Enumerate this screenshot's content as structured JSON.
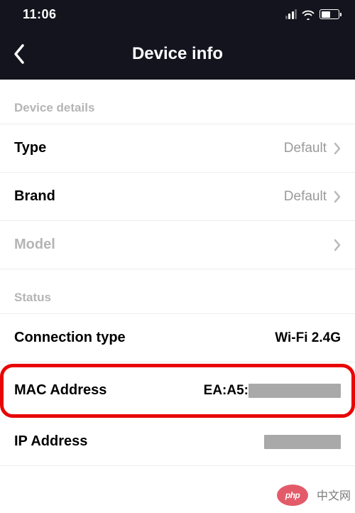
{
  "status_bar": {
    "time": "11:06"
  },
  "header": {
    "title": "Device info"
  },
  "sections": {
    "details": {
      "header": "Device details",
      "type": {
        "label": "Type",
        "value": "Default"
      },
      "brand": {
        "label": "Brand",
        "value": "Default"
      },
      "model": {
        "label": "Model"
      }
    },
    "status": {
      "header": "Status",
      "connection_type": {
        "label": "Connection type",
        "value": "Wi-Fi 2.4G"
      },
      "mac_address": {
        "label": "MAC Address",
        "value_prefix": "EA:A5:"
      },
      "ip_address": {
        "label": "IP Address"
      }
    }
  },
  "watermark": {
    "pill": "php",
    "text": "中文网"
  }
}
